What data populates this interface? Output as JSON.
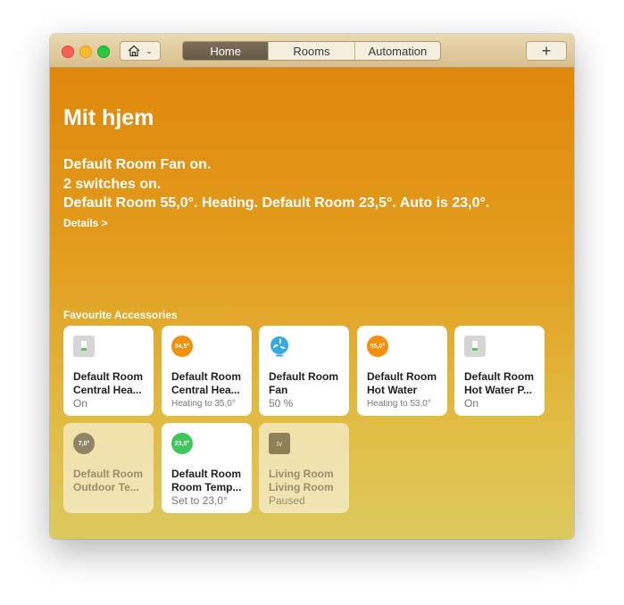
{
  "toolbar": {
    "tabs": [
      {
        "label": "Home",
        "active": true
      },
      {
        "label": "Rooms",
        "active": false
      },
      {
        "label": "Automation",
        "active": false
      }
    ],
    "add_label": "+"
  },
  "home": {
    "title": "Mit hjem",
    "status_lines": [
      "Default Room Fan on.",
      "2 switches on.",
      "Default Room 55,0°. Heating. Default Room 23,5°. Auto is 23,0°."
    ],
    "details_label": "Details >",
    "section_label": "Favourite Accessories"
  },
  "accessories": [
    {
      "line1": "Default Room",
      "line2": "Central Hea...",
      "state": "On",
      "icon": "switch-icon",
      "icon_text": ""
    },
    {
      "line1": "Default Room",
      "line2": "Central Hea...",
      "state": "Heating to 35,0°",
      "icon": "thermostat-icon",
      "icon_text": "34,5°",
      "icon_color": "#f4900c"
    },
    {
      "line1": "Default Room",
      "line2": "Fan",
      "state": "50 %",
      "icon": "fan-icon",
      "icon_text": ""
    },
    {
      "line1": "Default Room",
      "line2": "Hot Water",
      "state": "Heating to 53,0°",
      "icon": "thermostat-icon",
      "icon_text": "55,0°",
      "icon_color": "#f4900c"
    },
    {
      "line1": "Default Room",
      "line2": "Hot Water P...",
      "state": "On",
      "icon": "switch-icon",
      "icon_text": ""
    },
    {
      "line1": "Default Room",
      "line2": "Outdoor Te...",
      "state": "",
      "icon": "temperature-sensor-icon",
      "icon_text": "7,0°",
      "icon_color": "#8f8463"
    },
    {
      "line1": "Default Room",
      "line2": "Room Temp...",
      "state": "Set to 23,0°",
      "icon": "thermostat-icon",
      "icon_text": "23,5°",
      "icon_color": "#3fc85a"
    },
    {
      "line1": "Living Room",
      "line2": "Living Room",
      "state": "Paused",
      "icon": "apple-tv-icon",
      "icon_text": "tv"
    }
  ]
}
